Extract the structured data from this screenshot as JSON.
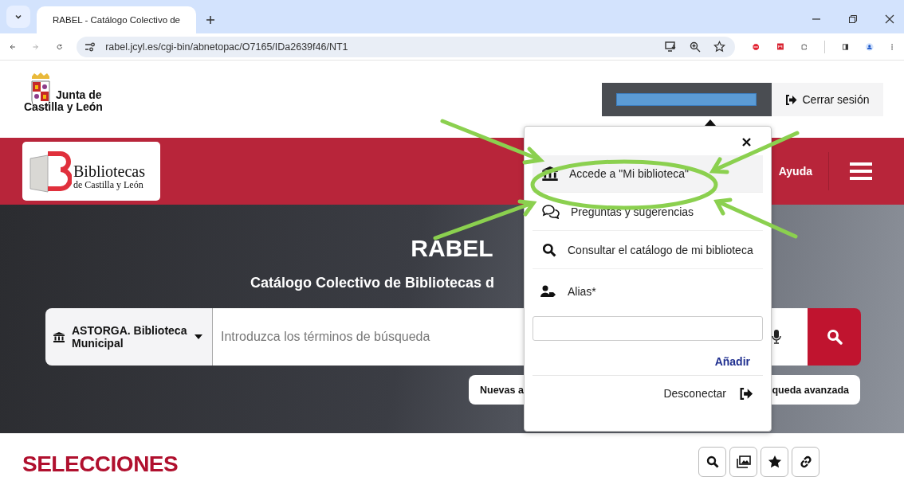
{
  "browser": {
    "tab_title": "RABEL - Catálogo Colectivo de",
    "url": "rabel.jcyl.es/cgi-bin/abnetopac/O7165/IDa2639f46/NT1"
  },
  "header": {
    "org_name_lines": [
      "Junta de",
      "Castilla y León"
    ],
    "logout": "Cerrar sesión"
  },
  "nav": {
    "logo_title": "Bibliotecas",
    "logo_subtitle": "de Castilla y León",
    "help": "Ayuda"
  },
  "hero": {
    "title": "RABEL",
    "subtitle": "Catálogo Colectivo de Bibliotecas d",
    "library": "ASTORGA. Biblioteca Municipal",
    "search_placeholder": "Introduzca los términos de búsqueda",
    "buttons": [
      "Nuevas a",
      "queda avanzada"
    ]
  },
  "selections": {
    "title": "SELECCIONES"
  },
  "user_menu": {
    "items": [
      {
        "label": "Accede a \"Mi biblioteca\"",
        "selected": true
      },
      {
        "label": "Preguntas y sugerencias",
        "selected": false
      },
      {
        "label": "Consultar el catálogo de mi biblioteca",
        "selected": false
      }
    ],
    "alias_label": "Alias*",
    "add": "Añadir",
    "disconnect": "Desconectar"
  }
}
